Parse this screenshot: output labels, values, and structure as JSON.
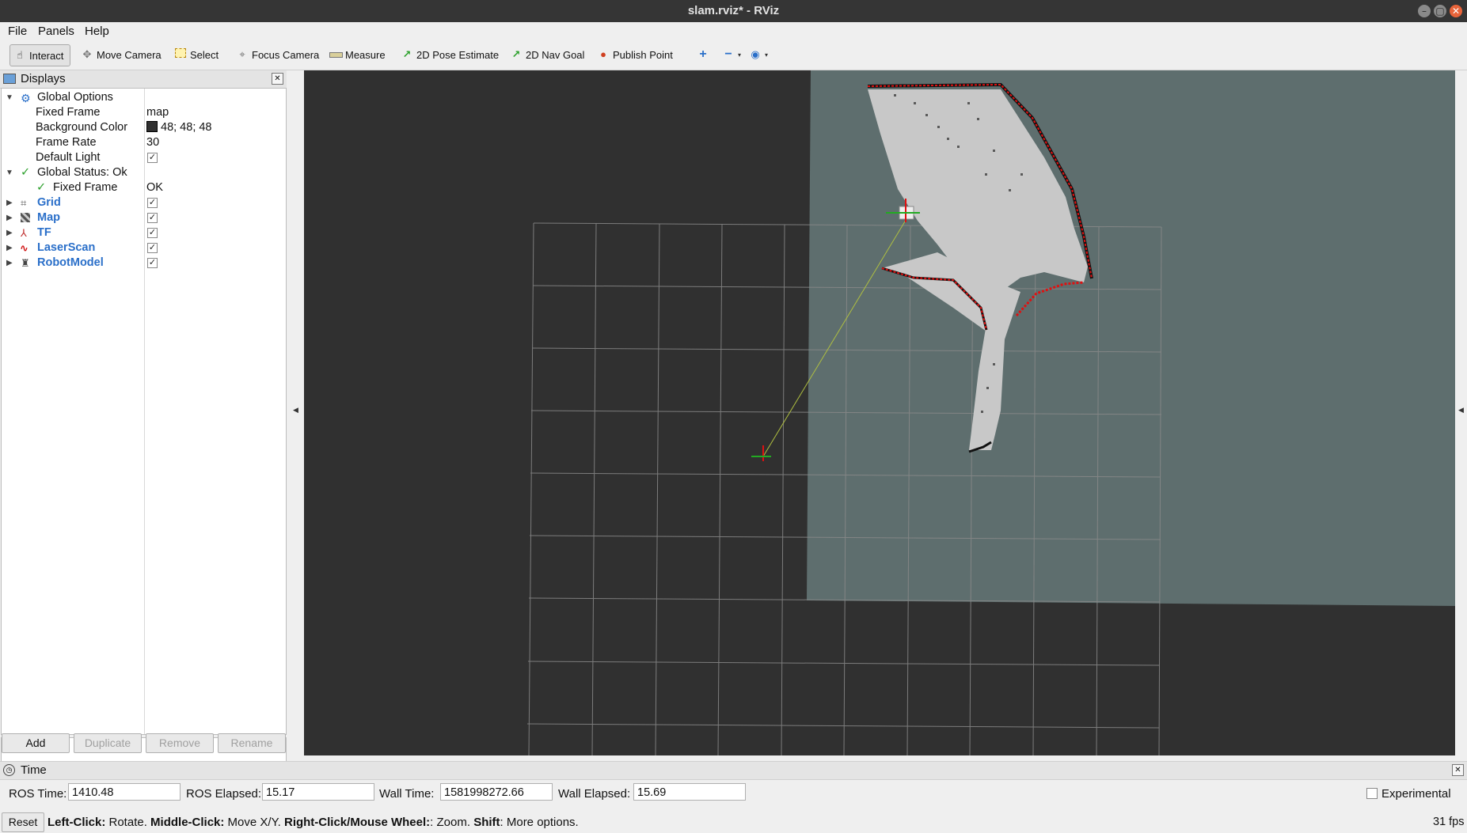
{
  "window": {
    "title": "slam.rviz* - RViz",
    "min_glyph": "–",
    "max_glyph": "▢",
    "close_glyph": "✕"
  },
  "menubar": {
    "items": [
      "File",
      "Panels",
      "Help"
    ]
  },
  "toolbar": {
    "interact": "Interact",
    "move_camera": "Move Camera",
    "select": "Select",
    "focus_camera": "Focus Camera",
    "measure": "Measure",
    "pose_estimate": "2D Pose Estimate",
    "nav_goal": "2D Nav Goal",
    "publish_point": "Publish Point"
  },
  "displays": {
    "title": "Displays",
    "global_options": "Global Options",
    "fixed_frame_label": "Fixed Frame",
    "fixed_frame_value": "map",
    "background_color_label": "Background Color",
    "background_color_value": "48; 48; 48",
    "frame_rate_label": "Frame Rate",
    "frame_rate_value": "30",
    "default_light_label": "Default Light",
    "global_status": "Global Status: Ok",
    "status_fixed_frame_label": "Fixed Frame",
    "status_fixed_frame_value": "OK",
    "items": [
      "Grid",
      "Map",
      "TF",
      "LaserScan",
      "RobotModel"
    ],
    "buttons": {
      "add": "Add",
      "duplicate": "Duplicate",
      "remove": "Remove",
      "rename": "Rename"
    }
  },
  "time": {
    "title": "Time",
    "ros_time_label": "ROS Time:",
    "ros_time": "1410.48",
    "ros_elapsed_label": "ROS Elapsed:",
    "ros_elapsed": "15.17",
    "wall_time_label": "Wall Time:",
    "wall_time": "1581998272.66",
    "wall_elapsed_label": "Wall Elapsed:",
    "wall_elapsed": "15.69",
    "experimental": "Experimental"
  },
  "status": {
    "reset": "Reset",
    "left_click": "Left-Click:",
    "left_click_desc": " Rotate. ",
    "middle_click": "Middle-Click:",
    "middle_click_desc": " Move X/Y. ",
    "right_click": "Right-Click/Mouse Wheel:",
    "right_click_desc": ": Zoom. ",
    "shift": "Shift",
    "shift_desc": ": More options.",
    "fps": "31 fps"
  },
  "colors": {
    "background": "#303030",
    "map_unknown": "#5e6e6e",
    "map_free": "#c8c8c8",
    "laser": "#e01010",
    "link_blue": "#2a6fc9"
  }
}
